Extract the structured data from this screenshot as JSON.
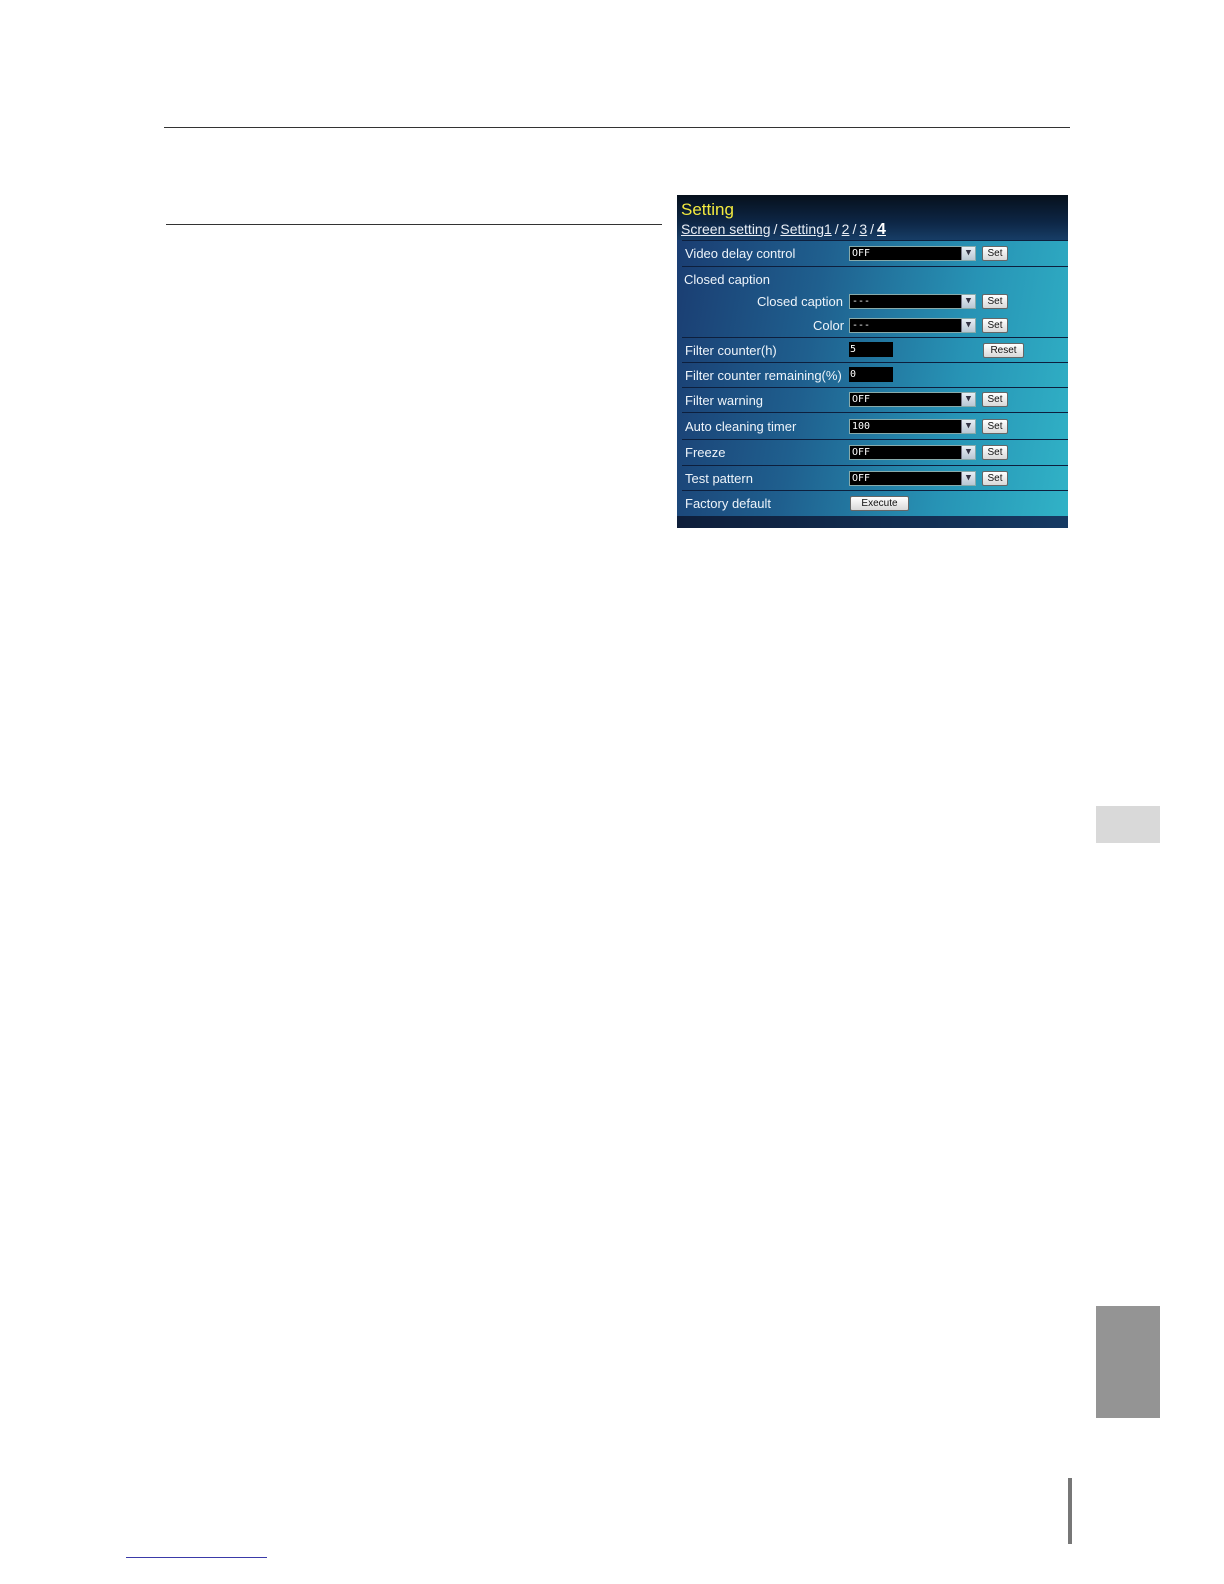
{
  "panel": {
    "title": "Setting",
    "breadcrumb": {
      "root": "Screen setting",
      "sep1": "/",
      "parent": "Setting1",
      "sep2": "/",
      "p2": "2",
      "sep3": "/",
      "p3": "3",
      "sep4": "/",
      "current": "4"
    },
    "rows": {
      "video_delay": {
        "label": "Video delay control",
        "value": "OFF",
        "button": "Set"
      },
      "closed_caption_group": {
        "label": "Closed caption"
      },
      "closed_caption": {
        "label": "Closed caption",
        "value": "---",
        "button": "Set"
      },
      "color": {
        "label": "Color",
        "value": "---",
        "button": "Set"
      },
      "filter_counter": {
        "label": "Filter counter(h)",
        "value": "5",
        "button": "Reset"
      },
      "filter_remaining": {
        "label": "Filter counter remaining(%)",
        "value": "0"
      },
      "filter_warning": {
        "label": "Filter warning",
        "value": "OFF",
        "button": "Set"
      },
      "auto_cleaning": {
        "label": "Auto cleaning timer",
        "value": "100",
        "button": "Set"
      },
      "freeze": {
        "label": "Freeze",
        "value": "OFF",
        "button": "Set"
      },
      "test_pattern": {
        "label": "Test pattern",
        "value": "OFF",
        "button": "Set"
      },
      "factory_default": {
        "label": "Factory default",
        "button": "Execute"
      }
    }
  },
  "colors": {
    "title_yellow": "#f3ea3f",
    "panel_dark": "#1a3b70",
    "panel_light": "#31b3c7"
  }
}
